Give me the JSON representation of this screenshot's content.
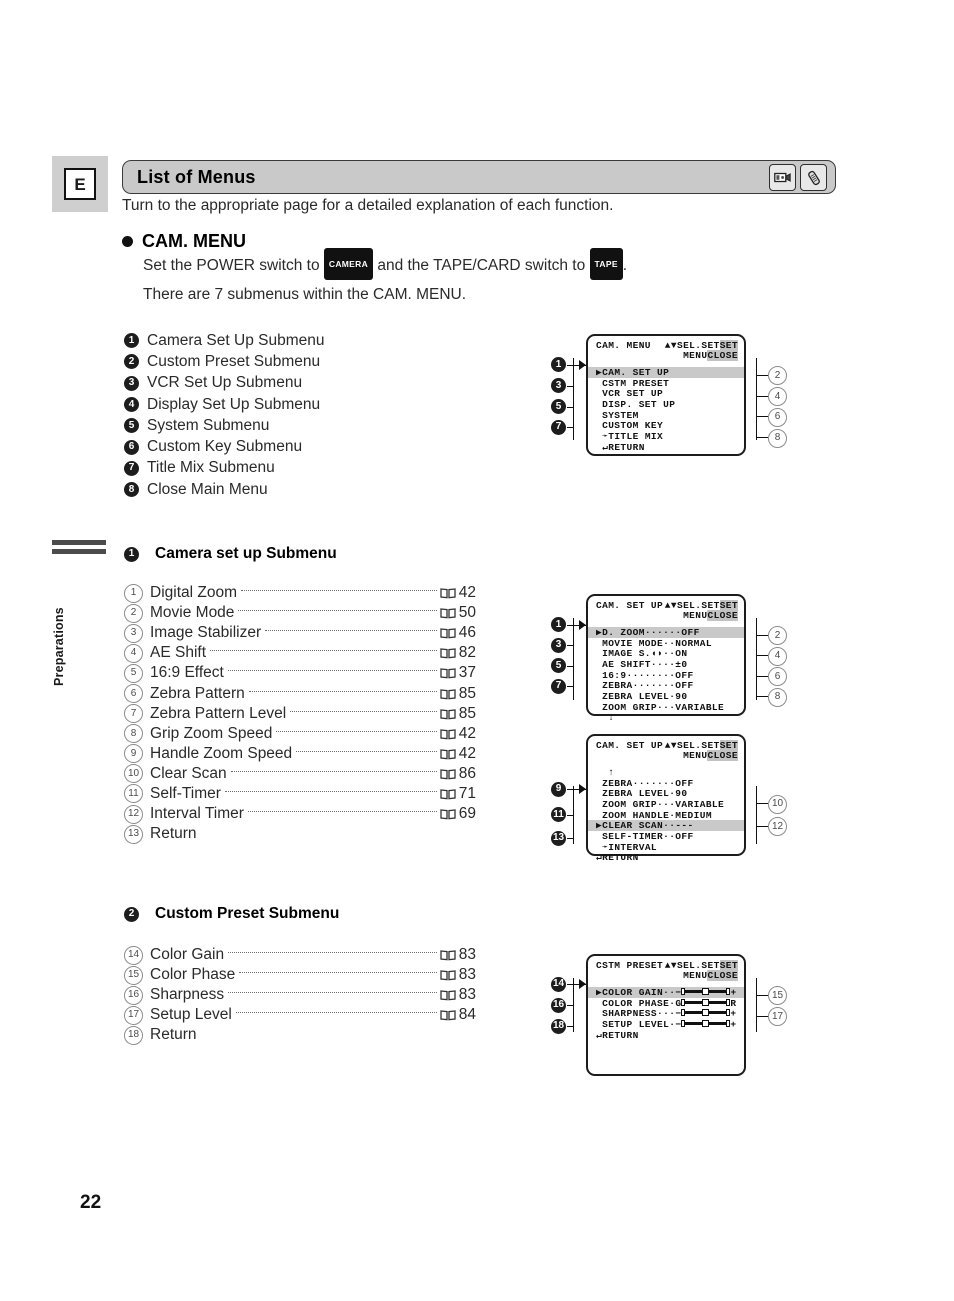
{
  "header": {
    "language_tag": "E",
    "title": "List of Menus",
    "icons": [
      "camcorder-icon",
      "remote-control-icon"
    ],
    "intro": "Turn to the appropriate page for a detailed explanation of each function."
  },
  "cam_menu": {
    "heading": "CAM. MENU",
    "line1_a": "Set the POWER switch to",
    "badge_camera": "CAMERA",
    "line1_b": "and the TAPE/CARD switch to",
    "badge_tape": "TAPE",
    "line1_c": ".",
    "line2": "There are 7 submenus within the CAM. MENU."
  },
  "submenu_list": [
    {
      "num": "1",
      "label": "Camera Set Up Submenu"
    },
    {
      "num": "2",
      "label": "Custom Preset Submenu"
    },
    {
      "num": "3",
      "label": "VCR Set Up Submenu"
    },
    {
      "num": "4",
      "label": "Display Set Up Submenu"
    },
    {
      "num": "5",
      "label": "System Submenu"
    },
    {
      "num": "6",
      "label": "Custom Key Submenu"
    },
    {
      "num": "7",
      "label": "Title Mix Submenu"
    },
    {
      "num": "8",
      "label": "Close Main Menu"
    }
  ],
  "sidebar": {
    "tab_label": "Preparations"
  },
  "section1": {
    "num": "1",
    "heading": "Camera set up Submenu",
    "items": [
      {
        "num": "1",
        "label": "Digital Zoom",
        "page": "42"
      },
      {
        "num": "2",
        "label": "Movie Mode",
        "page": "50"
      },
      {
        "num": "3",
        "label": "Image Stabilizer",
        "page": "46"
      },
      {
        "num": "4",
        "label": "AE Shift",
        "page": "82"
      },
      {
        "num": "5",
        "label": "16:9 Effect",
        "page": "37"
      },
      {
        "num": "6",
        "label": "Zebra Pattern",
        "page": "85"
      },
      {
        "num": "7",
        "label": "Zebra Pattern Level",
        "page": "85"
      },
      {
        "num": "8",
        "label": "Grip Zoom Speed",
        "page": "42"
      },
      {
        "num": "9",
        "label": "Handle Zoom Speed",
        "page": "42"
      },
      {
        "num": "10",
        "label": "Clear Scan",
        "page": "86"
      },
      {
        "num": "11",
        "label": "Self-Timer",
        "page": "71"
      },
      {
        "num": "12",
        "label": "Interval Timer",
        "page": "69"
      },
      {
        "num": "13",
        "label": "Return",
        "page": ""
      }
    ]
  },
  "section2": {
    "num": "2",
    "heading": "Custom Preset Submenu",
    "items": [
      {
        "num": "14",
        "label": "Color Gain",
        "page": "83"
      },
      {
        "num": "15",
        "label": "Color Phase",
        "page": "83"
      },
      {
        "num": "16",
        "label": "Sharpness",
        "page": "83"
      },
      {
        "num": "17",
        "label": "Setup Level",
        "page": "84"
      },
      {
        "num": "18",
        "label": "Return",
        "page": ""
      }
    ]
  },
  "panels": {
    "cam_menu": {
      "title": "CAM. MENU",
      "hint_sel": "▲▼SEL.",
      "hint_set_plain": "SET",
      "hint_set_hl": "SET",
      "hint_menu_plain": "MENU",
      "hint_close_hl": "CLOSE",
      "rows": [
        {
          "text": "▶CAM. SET UP",
          "selected": true
        },
        {
          "text": " CSTM PRESET",
          "selected": false
        },
        {
          "text": " VCR SET UP",
          "selected": false
        },
        {
          "text": " DISP. SET UP",
          "selected": false
        },
        {
          "text": " SYSTEM",
          "selected": false
        },
        {
          "text": " CUSTOM KEY",
          "selected": false
        },
        {
          "text": " ➛TITLE MIX",
          "selected": false
        },
        {
          "text": " ↵RETURN",
          "selected": false
        }
      ],
      "callouts_left": [
        "1",
        "3",
        "5",
        "7"
      ],
      "callouts_right": [
        "2",
        "4",
        "6",
        "8"
      ]
    },
    "cam_setup_1": {
      "title": "CAM. SET UP",
      "hint_sel": "▲▼SEL.",
      "hint_set_plain": "SET",
      "hint_set_hl": "SET",
      "hint_menu_plain": "MENU",
      "hint_close_hl": "CLOSE",
      "rows": [
        {
          "text": "▶D. ZOOM······OFF",
          "selected": true
        },
        {
          "text": " MOVIE MODE··NORMAL",
          "selected": false
        },
        {
          "text": " IMAGE S.◖◗··ON",
          "selected": false
        },
        {
          "text": " AE SHIFT····±0",
          "selected": false
        },
        {
          "text": " 16:9········OFF",
          "selected": false
        },
        {
          "text": " ZEBRA·······OFF",
          "selected": false
        },
        {
          "text": " ZEBRA LEVEL·90",
          "selected": false
        },
        {
          "text": " ZOOM GRIP···VARIABLE",
          "selected": false
        },
        {
          "text": "  ↓",
          "selected": false
        }
      ],
      "callouts_left": [
        "1",
        "3",
        "5",
        "7"
      ],
      "callouts_right": [
        "2",
        "4",
        "6",
        "8"
      ]
    },
    "cam_setup_2": {
      "title": "CAM. SET UP",
      "hint_sel": "▲▼SEL.",
      "hint_set_plain": "SET",
      "hint_set_hl": "SET",
      "hint_menu_plain": "MENU",
      "hint_close_hl": "CLOSE",
      "rows": [
        {
          "text": "  ↑",
          "selected": false
        },
        {
          "text": " ZEBRA·······OFF",
          "selected": false
        },
        {
          "text": " ZEBRA LEVEL·90",
          "selected": false
        },
        {
          "text": " ZOOM GRIP···VARIABLE",
          "selected": false
        },
        {
          "text": " ZOOM HANDLE·MEDIUM",
          "selected": false
        },
        {
          "text": "▶CLEAR SCAN··---",
          "selected": true
        },
        {
          "text": " SELF-TIMER··OFF",
          "selected": false
        },
        {
          "text": " ➛INTERVAL",
          "selected": false
        },
        {
          "text": "↵RETURN",
          "selected": false
        }
      ],
      "callouts_left": [
        "9",
        "11",
        "13"
      ],
      "callouts_right": [
        "10",
        "12"
      ]
    },
    "cstm_preset": {
      "title": "CSTM PRESET",
      "hint_sel": "▲▼SEL.",
      "hint_set_plain": "SET",
      "hint_set_hl": "SET",
      "hint_menu_plain": "MENU",
      "hint_close_hl": "CLOSE",
      "rows": [
        {
          "label": "▶COLOR GAIN··",
          "left": "−",
          "right": "+",
          "selected": true
        },
        {
          "label": " COLOR PHASE·",
          "left": "G",
          "right": "R",
          "selected": false
        },
        {
          "label": " SHARPNESS···",
          "left": "−",
          "right": "+",
          "selected": false
        },
        {
          "label": " SETUP LEVEL·",
          "left": "−",
          "right": "+",
          "selected": false
        },
        {
          "label": "↵RETURN",
          "left": "",
          "right": "",
          "selected": false
        }
      ],
      "callouts_left": [
        "14",
        "16",
        "18"
      ],
      "callouts_right": [
        "15",
        "17"
      ]
    }
  },
  "folio": "22"
}
